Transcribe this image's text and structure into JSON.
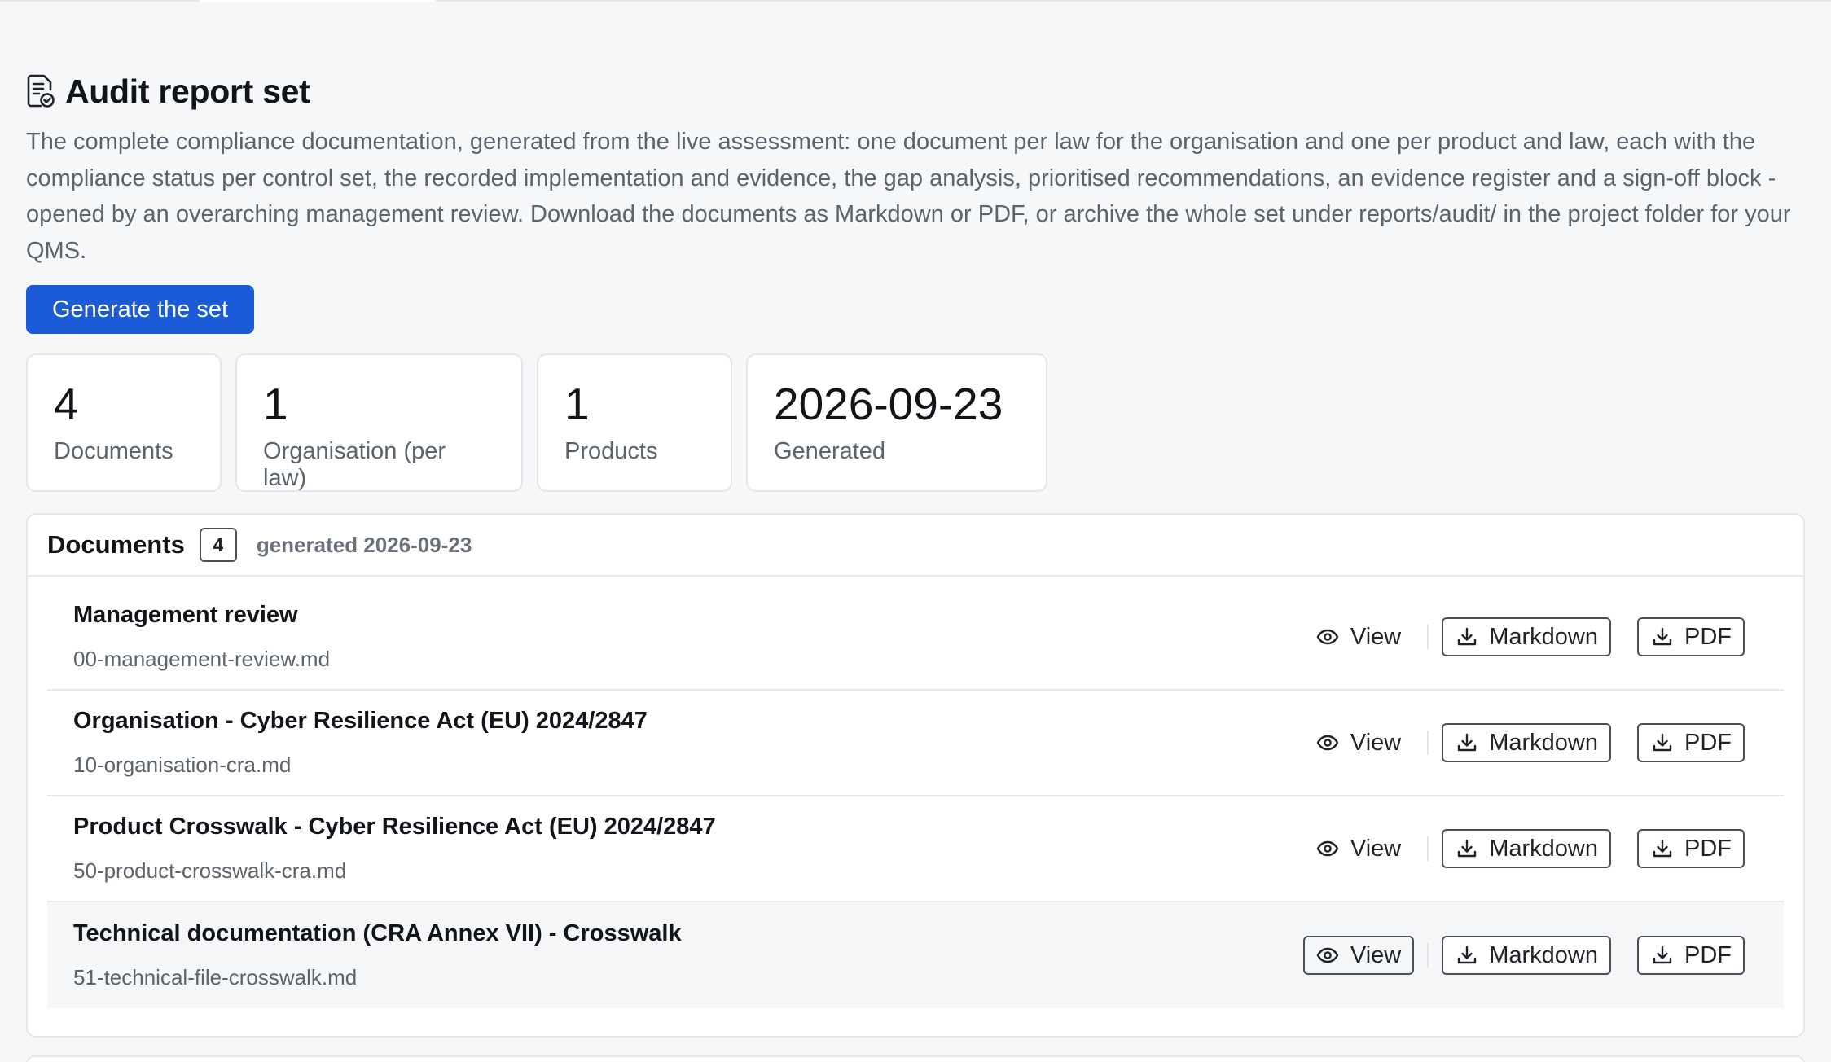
{
  "header": {
    "title": "Audit report set",
    "description": "The complete compliance documentation, generated from the live assessment: one document per law for the organisation and one per product and law, each with the compliance status per control set, the recorded implementation and evidence, the gap analysis, prioritised recommendations, an evidence register and a sign-off block - opened by an overarching management review. Download the documents as Markdown or PDF, or archive the whole set under reports/audit/ in the project folder for your QMS.",
    "generate_label": "Generate the set"
  },
  "stats": [
    {
      "value": "4",
      "label": "Documents"
    },
    {
      "value": "1",
      "label": "Organisation (per law)"
    },
    {
      "value": "1",
      "label": "Products"
    },
    {
      "value": "2026-09-23",
      "label": "Generated"
    }
  ],
  "documents": {
    "title": "Documents",
    "count": "4",
    "meta": "generated 2026-09-23",
    "view_label": "View",
    "markdown_label": "Markdown",
    "pdf_label": "PDF",
    "items": [
      {
        "title": "Management review",
        "file": "00-management-review.md"
      },
      {
        "title": "Organisation - Cyber Resilience Act (EU) 2024/2847",
        "file": "10-organisation-cra.md"
      },
      {
        "title": "Product Crosswalk - Cyber Resilience Act (EU) 2024/2847",
        "file": "50-product-crosswalk-cra.md"
      },
      {
        "title": "Technical documentation (CRA Annex VII) - Crosswalk",
        "file": "51-technical-file-crosswalk.md"
      }
    ]
  },
  "colors": {
    "primary": "#1b5bd8",
    "background": "#f6f7f9",
    "text_muted": "#5b636d"
  },
  "icons": {
    "header": "report-check-icon",
    "view": "eye-icon",
    "download": "download-icon"
  }
}
